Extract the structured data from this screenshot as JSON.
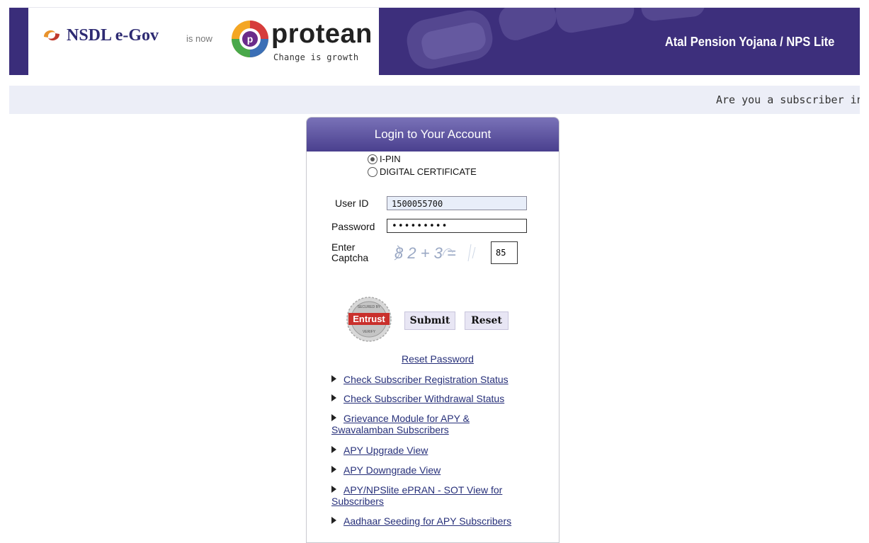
{
  "header": {
    "nsdl_logo": "NSDL e-Gov",
    "is_now": "is now",
    "protean_name": "protean",
    "protean_tagline": "Change is growth",
    "banner_title": "Atal Pension Yojana / NPS Lite"
  },
  "marquee": {
    "text": "Are you a subscriber in"
  },
  "login": {
    "title": "Login to Your Account",
    "auth_options": [
      {
        "label": "I-PIN",
        "selected": true
      },
      {
        "label": "DIGITAL CERTIFICATE",
        "selected": false
      }
    ],
    "user_id_label": "User ID",
    "user_id_value": "1500055700",
    "password_label": "Password",
    "password_value": "•••••••••",
    "captcha_label": "Enter Captcha",
    "captcha_expression": "8 2 + 3 =",
    "captcha_value": "85",
    "submit_label": "Submit",
    "reset_label": "Reset",
    "reset_password_link": "Reset Password"
  },
  "links": [
    "Check Subscriber Registration Status",
    "Check Subscriber Withdrawal Status",
    "Grievance Module for APY & Swavalamban Subscribers",
    "APY Upgrade View",
    "APY Downgrade View",
    "APY/NPSlite ePRAN - SOT View for Subscribers",
    "Aadhaar Seeding for APY Subscribers"
  ],
  "colors": {
    "banner": "#3d2f7c",
    "link": "#27307a",
    "marquee_bg": "#eceef7"
  }
}
